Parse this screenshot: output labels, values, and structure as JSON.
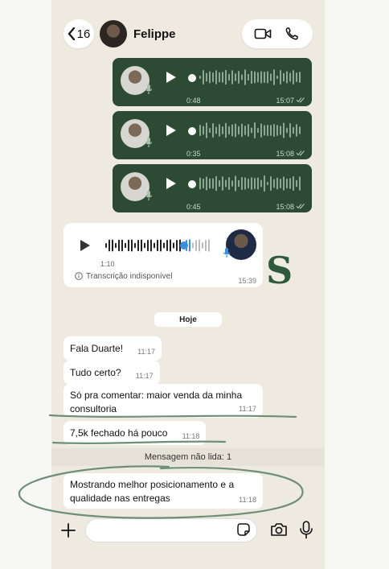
{
  "header": {
    "back_count": "16",
    "contact_name": "Felippe"
  },
  "voice_messages_sent": [
    {
      "duration": "0:48",
      "time": "15:07"
    },
    {
      "duration": "0:35",
      "time": "15:08"
    },
    {
      "duration": "0:45",
      "time": "15:08"
    }
  ],
  "voice_message_received": {
    "duration": "1:10",
    "transcription": "Transcrição indisponível",
    "time": "15:39"
  },
  "overlay_letter": "S",
  "date_chip": "Hoje",
  "messages": [
    {
      "text": "Fala Duarte!",
      "time": "11:17"
    },
    {
      "text": "Tudo certo?",
      "time": "11:17"
    },
    {
      "text": "Só pra comentar: maior venda da minha consultoria",
      "time": "11:17"
    },
    {
      "text": "7,5k fechado há pouco",
      "time": "11:18"
    },
    {
      "text": "Mostrando melhor posicionamento e a qualidade nas entregas",
      "time": "11:18"
    }
  ],
  "unread_label": "Mensagem não lida: 1",
  "input": {
    "placeholder": ""
  },
  "colors": {
    "sent_bubble": "#2c4a34",
    "accent_green": "#2d5a3d",
    "annotation": "#6d8f78",
    "background": "#efeae0"
  },
  "icons": [
    "chevron-left-icon",
    "video-call-icon",
    "phone-icon",
    "play-icon",
    "mic-icon",
    "double-check-icon",
    "info-icon",
    "plus-icon",
    "sticker-icon",
    "camera-icon"
  ]
}
